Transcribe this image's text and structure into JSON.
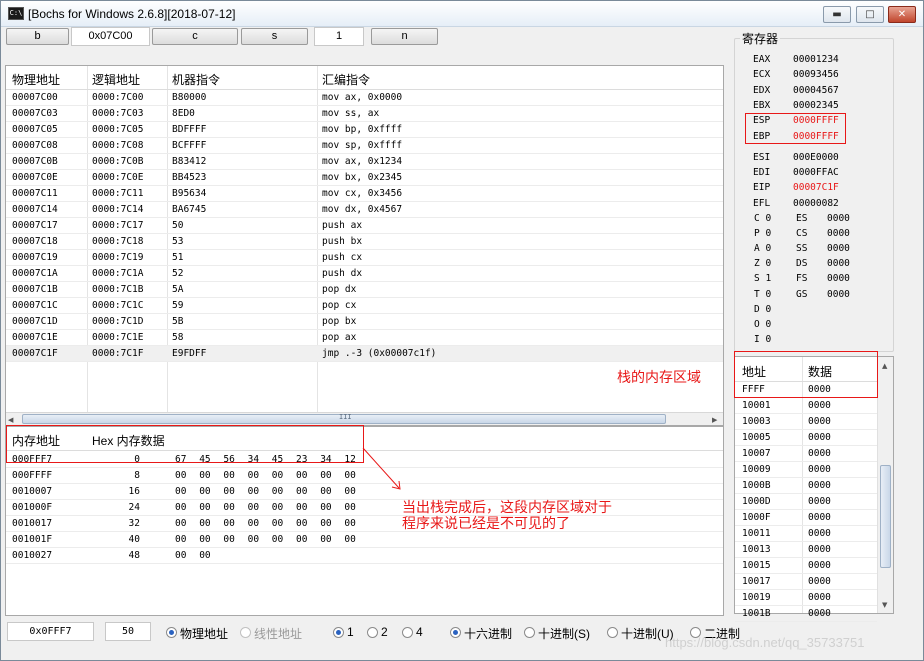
{
  "window": {
    "title": "[Bochs for Windows 2.6.8][2018-07-12]",
    "icon_text": "C:\\"
  },
  "title_buttons": {
    "minimize": "▬",
    "maximize": "□",
    "close": "✕"
  },
  "toolbar": {
    "b_label": "b",
    "addr_value": "0x07C00",
    "c_label": "c",
    "s_label": "s",
    "step_value": "1",
    "n_label": "n"
  },
  "disasm": {
    "headers": [
      "物理地址",
      "逻辑地址",
      "机器指令",
      "汇编指令"
    ],
    "rows": [
      [
        "00007C00",
        "0000:7C00",
        "B80000",
        "mov ax, 0x0000"
      ],
      [
        "00007C03",
        "0000:7C03",
        "8ED0",
        "mov ss, ax"
      ],
      [
        "00007C05",
        "0000:7C05",
        "BDFFFF",
        "mov bp, 0xffff"
      ],
      [
        "00007C08",
        "0000:7C08",
        "BCFFFF",
        "mov sp, 0xffff"
      ],
      [
        "00007C0B",
        "0000:7C0B",
        "B83412",
        "mov ax, 0x1234"
      ],
      [
        "00007C0E",
        "0000:7C0E",
        "BB4523",
        "mov bx, 0x2345"
      ],
      [
        "00007C11",
        "0000:7C11",
        "B95634",
        "mov cx, 0x3456"
      ],
      [
        "00007C14",
        "0000:7C14",
        "BA6745",
        "mov dx, 0x4567"
      ],
      [
        "00007C17",
        "0000:7C17",
        "50",
        "push ax"
      ],
      [
        "00007C18",
        "0000:7C18",
        "53",
        "push bx"
      ],
      [
        "00007C19",
        "0000:7C19",
        "51",
        "push cx"
      ],
      [
        "00007C1A",
        "0000:7C1A",
        "52",
        "push dx"
      ],
      [
        "00007C1B",
        "0000:7C1B",
        "5A",
        "pop dx"
      ],
      [
        "00007C1C",
        "0000:7C1C",
        "59",
        "pop cx"
      ],
      [
        "00007C1D",
        "0000:7C1D",
        "5B",
        "pop bx"
      ],
      [
        "00007C1E",
        "0000:7C1E",
        "58",
        "pop ax"
      ],
      [
        "00007C1F",
        "0000:7C1F",
        "E9FDFF",
        "jmp .-3 (0x00007c1f)"
      ]
    ],
    "scroll_grip": "III"
  },
  "memory": {
    "headers": [
      "内存地址",
      "Hex 内存数据"
    ],
    "rows": [
      [
        "000FFF7",
        "0",
        "67",
        "45",
        "56",
        "34",
        "45",
        "23",
        "34",
        "12"
      ],
      [
        "000FFFF",
        "8",
        "00",
        "00",
        "00",
        "00",
        "00",
        "00",
        "00",
        "00"
      ],
      [
        "0010007",
        "16",
        "00",
        "00",
        "00",
        "00",
        "00",
        "00",
        "00",
        "00"
      ],
      [
        "001000F",
        "24",
        "00",
        "00",
        "00",
        "00",
        "00",
        "00",
        "00",
        "00"
      ],
      [
        "0010017",
        "32",
        "00",
        "00",
        "00",
        "00",
        "00",
        "00",
        "00",
        "00"
      ],
      [
        "001001F",
        "40",
        "00",
        "00",
        "00",
        "00",
        "00",
        "00",
        "00",
        "00"
      ],
      [
        "0010027",
        "48",
        "00",
        "00",
        "",
        "",
        "",
        "",
        "",
        ""
      ]
    ]
  },
  "registers": {
    "title": "寄存器",
    "general": [
      [
        "EAX",
        "00001234"
      ],
      [
        "ECX",
        "00093456"
      ],
      [
        "EDX",
        "00004567"
      ],
      [
        "EBX",
        "00002345"
      ],
      [
        "ESP",
        "0000FFFF"
      ],
      [
        "EBP",
        "0000FFFF"
      ],
      [
        "ESI",
        "000E0000"
      ],
      [
        "EDI",
        "0000FFAC"
      ],
      [
        "EIP",
        "00007C1F"
      ],
      [
        "EFL",
        "00000082"
      ]
    ],
    "flags": [
      "C 0",
      "P 0",
      "A 0",
      "Z 0",
      "S 1",
      "T 0",
      "D 0",
      "O 0",
      "I 0"
    ],
    "segments": [
      [
        "ES",
        "0000"
      ],
      [
        "CS",
        "0000"
      ],
      [
        "SS",
        "0000"
      ],
      [
        "DS",
        "0000"
      ],
      [
        "FS",
        "0000"
      ],
      [
        "GS",
        "0000"
      ]
    ]
  },
  "stack": {
    "headers": [
      "地址",
      "数据"
    ],
    "rows": [
      [
        "FFFF",
        "0000"
      ],
      [
        "10001",
        "0000"
      ],
      [
        "10003",
        "0000"
      ],
      [
        "10005",
        "0000"
      ],
      [
        "10007",
        "0000"
      ],
      [
        "10009",
        "0000"
      ],
      [
        "1000B",
        "0000"
      ],
      [
        "1000D",
        "0000"
      ],
      [
        "1000F",
        "0000"
      ],
      [
        "10011",
        "0000"
      ],
      [
        "10013",
        "0000"
      ],
      [
        "10015",
        "0000"
      ],
      [
        "10017",
        "0000"
      ],
      [
        "10019",
        "0000"
      ],
      [
        "1001B",
        "0000"
      ]
    ]
  },
  "annotations": {
    "stack_region": "栈的内存区域",
    "after_pop_line1": "当出栈完成后，这段内存区域对于",
    "after_pop_line2": "程序来说已经是不可见的了"
  },
  "status": {
    "address_value": "0x0FFF7",
    "length_value": "50",
    "radio_physical": "物理地址",
    "radio_linear": "线性地址",
    "radio_1": "1",
    "radio_2": "2",
    "radio_4": "4",
    "radio_hex": "十六进制",
    "radio_dec_s": "十进制(S)",
    "radio_dec_u": "十进制(U)",
    "radio_bin": "二进制"
  },
  "watermark": "https://blog.csdn.net/qq_35733751",
  "colors": {
    "annotation_red": "#e81818",
    "selected_row": "#f0f0f0"
  }
}
